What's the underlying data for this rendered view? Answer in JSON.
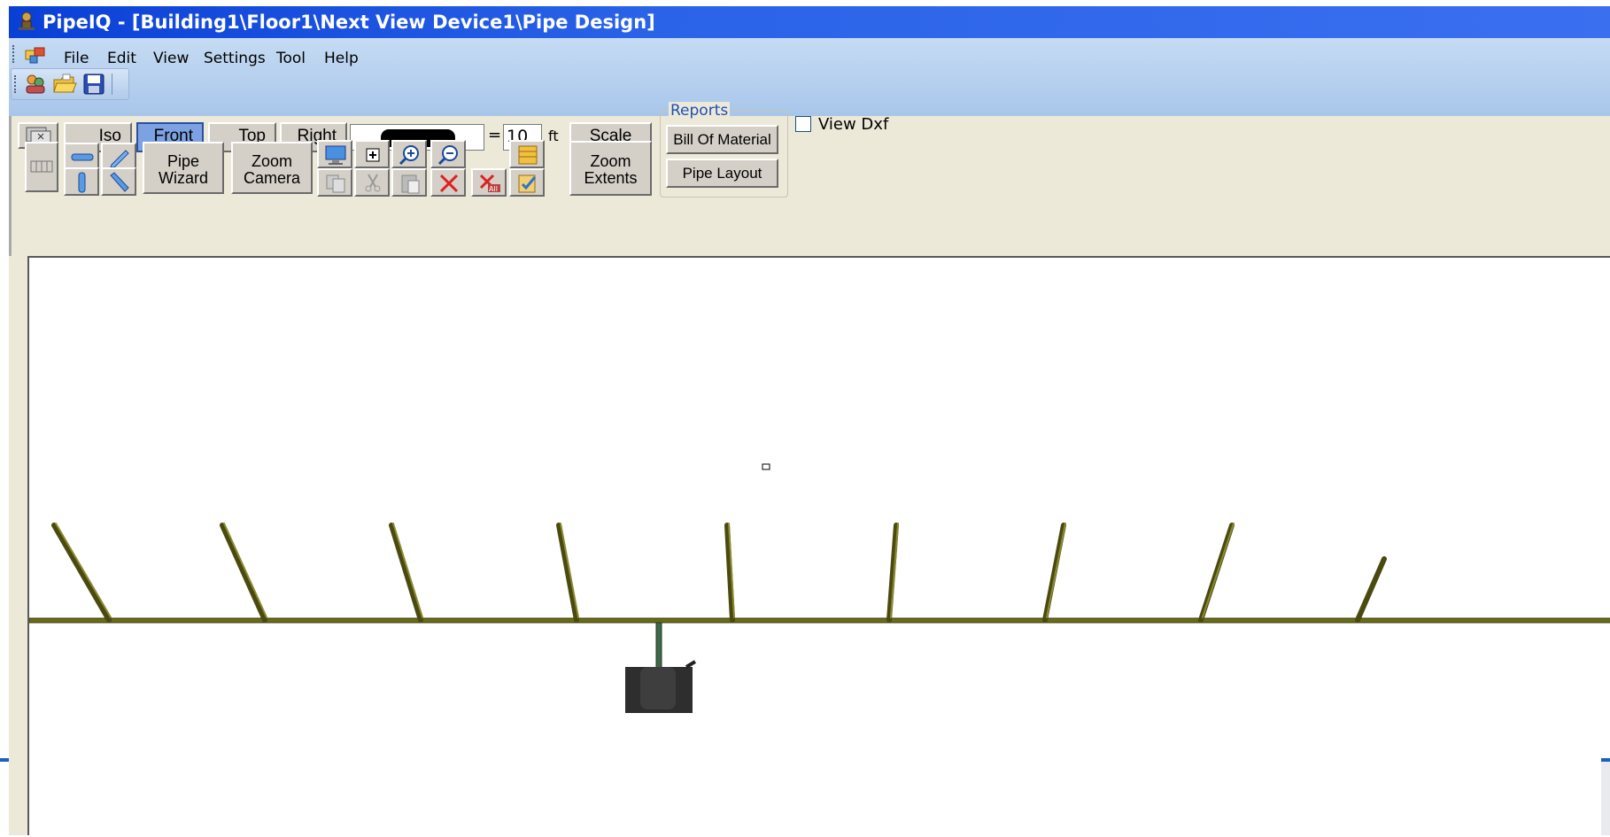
{
  "window": {
    "title": "PipeIQ - [Building1\\Floor1\\Next View Device1\\Pipe Design]"
  },
  "menu": {
    "items": [
      "File",
      "Edit",
      "View",
      "Settings",
      "Tool",
      "Help"
    ]
  },
  "toolbar": {
    "views": {
      "iso": "Iso",
      "front": "Front",
      "top": "Top",
      "right": "Right"
    },
    "active_view": "Front",
    "scale": {
      "equals": "=",
      "value": "10",
      "unit": "ft",
      "button": "Scale"
    },
    "pipe_wizard": [
      "Pipe",
      "Wizard"
    ],
    "zoom_camera": [
      "Zoom",
      "Camera"
    ],
    "zoom_extents": [
      "Zoom",
      "Extents"
    ],
    "reports": {
      "legend": "Reports",
      "bill_of_material": "Bill Of Material",
      "pipe_layout": "Pipe Layout"
    },
    "view_dxf": {
      "label": "View Dxf",
      "checked": false
    }
  },
  "colors": {
    "title_bar": "#0a3fd6",
    "pipe": "#6b6b1a",
    "active_view": "#7da2e3"
  }
}
